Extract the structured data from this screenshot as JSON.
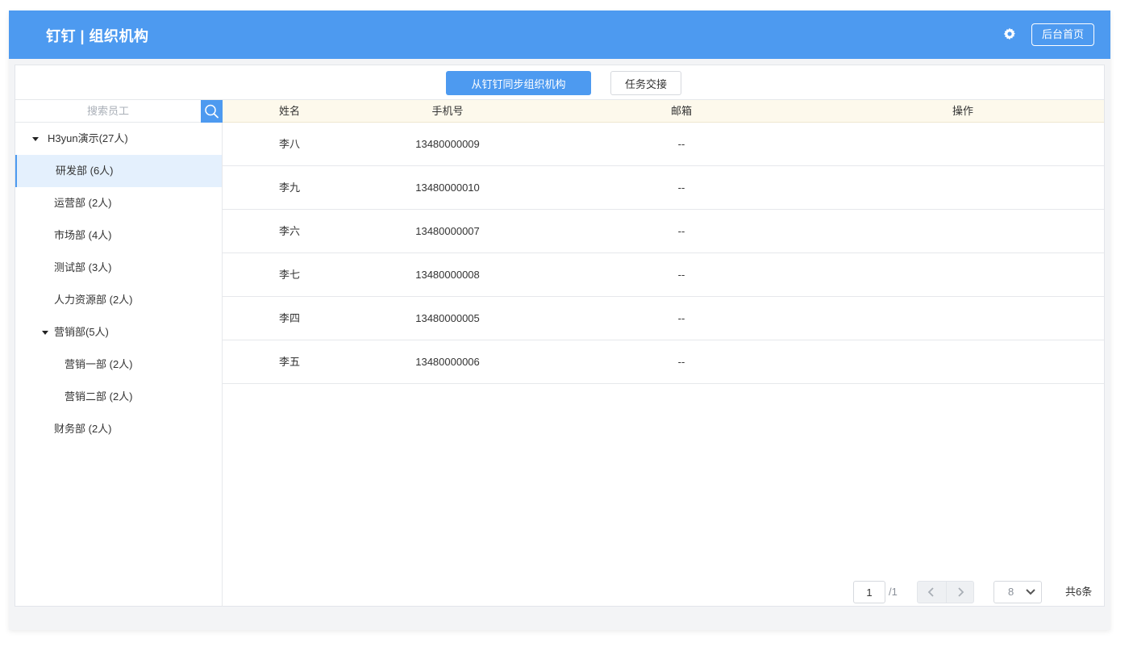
{
  "header": {
    "title": "钉钉 | 组织机构",
    "admin_home_label": "后台首页",
    "settings_icon": "gear-icon"
  },
  "actions": {
    "sync_label": "从钉钉同步组织机构",
    "handover_label": "任务交接"
  },
  "search": {
    "placeholder": "搜索员工",
    "icon": "search-icon"
  },
  "tree": [
    {
      "label": "H3yun演示(27人)",
      "level": 0,
      "expanded": true
    },
    {
      "label": "研发部 (6人)",
      "level": 1,
      "selected": true
    },
    {
      "label": "运营部 (2人)",
      "level": 1
    },
    {
      "label": "市场部 (4人)",
      "level": 1
    },
    {
      "label": "测试部 (3人)",
      "level": 1
    },
    {
      "label": "人力资源部 (2人)",
      "level": 1
    },
    {
      "label": "营销部(5人)",
      "level": 1,
      "expanded": true
    },
    {
      "label": "营销一部 (2人)",
      "level": 2
    },
    {
      "label": "营销二部 (2人)",
      "level": 2
    },
    {
      "label": "财务部 (2人)",
      "level": 1
    }
  ],
  "table": {
    "columns": [
      "姓名",
      "手机号",
      "邮箱",
      "操作"
    ],
    "rows": [
      {
        "name": "李八",
        "phone": "13480000009",
        "email": "--",
        "action": ""
      },
      {
        "name": "李九",
        "phone": "13480000010",
        "email": "--",
        "action": ""
      },
      {
        "name": "李六",
        "phone": "13480000007",
        "email": "--",
        "action": ""
      },
      {
        "name": "李七",
        "phone": "13480000008",
        "email": "--",
        "action": ""
      },
      {
        "name": "李四",
        "phone": "13480000005",
        "email": "--",
        "action": ""
      },
      {
        "name": "李五",
        "phone": "13480000006",
        "email": "--",
        "action": ""
      }
    ]
  },
  "pagination": {
    "current_page": "1",
    "total_pages": "/1",
    "page_size": "8",
    "total_count": "共6条"
  },
  "colors": {
    "primary": "#4d9af0",
    "header_row": "#fdf9ec",
    "selected_row": "#e4f0fd"
  }
}
